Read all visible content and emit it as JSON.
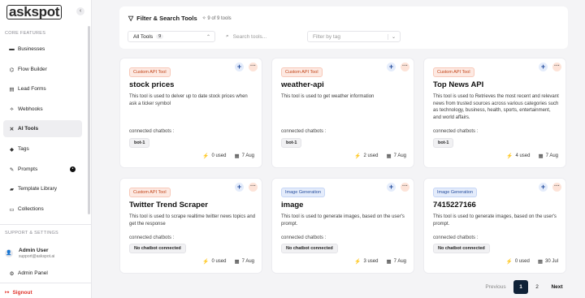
{
  "sidebar": {
    "logo": "askspot",
    "collapse_icon": "chevron-left",
    "section_core": "CORE FEATURES",
    "items": [
      {
        "label": "Businesses",
        "icon": "briefcase-icon",
        "glyph": "▬"
      },
      {
        "label": "Flow Builder",
        "icon": "flow-icon",
        "glyph": "⌬"
      },
      {
        "label": "Lead Forms",
        "icon": "form-icon",
        "glyph": "▤"
      },
      {
        "label": "Webhooks",
        "icon": "webhook-icon",
        "glyph": "⟡"
      },
      {
        "label": "AI Tools",
        "icon": "tools-icon",
        "glyph": "✕"
      },
      {
        "label": "Tags",
        "icon": "tag-icon",
        "glyph": "◆"
      },
      {
        "label": "Prompts",
        "icon": "prompt-icon",
        "glyph": "✎"
      },
      {
        "label": "Template Library",
        "icon": "library-icon",
        "glyph": "▰"
      },
      {
        "label": "Collections",
        "icon": "collection-icon",
        "glyph": "▭"
      }
    ],
    "active_index": 4,
    "section_support": "SUPPORT & SETTINGS",
    "user": {
      "name": "Admin User",
      "email": "support@askspot.ai"
    },
    "admin_panel": "Admin Panel",
    "signout": "Signout"
  },
  "filter": {
    "title": "Filter & Search Tools",
    "count": "9 of 9 tools",
    "category_value": "All Tools",
    "category_count": "9",
    "search_placeholder": "Search tools...",
    "tag_placeholder": "Filter by tag"
  },
  "cards": [
    {
      "tag": "Custom API Tool",
      "tag_type": "custom",
      "title": "stock prices",
      "desc": "This tool is used to delver up to date stock prices when ask a ticker symbol",
      "cc_label": "connected chatbots :",
      "chip": "bot-1",
      "used": "0 used",
      "date": "7 Aug"
    },
    {
      "tag": "Custom API Tool",
      "tag_type": "custom",
      "title": "weather-api",
      "desc": "This tool is used to get weather information",
      "cc_label": "connected chatbots :",
      "chip": "bot-1",
      "used": "2 used",
      "date": "7 Aug"
    },
    {
      "tag": "Custom API Tool",
      "tag_type": "custom",
      "title": "Top News API",
      "desc": "This tool is used to Retrieves the most recent and relevant news from trusted sources across various categories such as technology, business, health, sports, entertainment, and world affairs.",
      "cc_label": "connected chatbots :",
      "chip": "bot-1",
      "used": "4 used",
      "date": "7 Aug"
    },
    {
      "tag": "Custom API Tool",
      "tag_type": "custom",
      "title": "Twitter Trend Scraper",
      "desc": "This tool is used to scrape realtime twitter news topics and get the response",
      "cc_label": "connected chatbots :",
      "chip": "No chatbot connected",
      "used": "0 used",
      "date": "7 Aug"
    },
    {
      "tag": "Image Generation",
      "tag_type": "image",
      "title": "image",
      "desc": "This tool is used to generate images, based on the user's prompt.",
      "cc_label": "connected chatbots :",
      "chip": "No chatbot connected",
      "used": "3 used",
      "date": "7 Aug"
    },
    {
      "tag": "Image Generation",
      "tag_type": "image",
      "title": "7415227166",
      "desc": "This tool is used to generate images, based on the user's prompt.",
      "cc_label": "connected chatbots :",
      "chip": "No chatbot connected",
      "used": "0 used",
      "date": "30 Jul"
    }
  ],
  "pagination": {
    "prev": "Previous",
    "pages": [
      "1",
      "2"
    ],
    "current": "1",
    "next": "Next"
  },
  "colors": {
    "accent": "#0f2237",
    "signout": "#e0342c",
    "custom_tag": "#c14418",
    "image_tag": "#284f9e"
  }
}
